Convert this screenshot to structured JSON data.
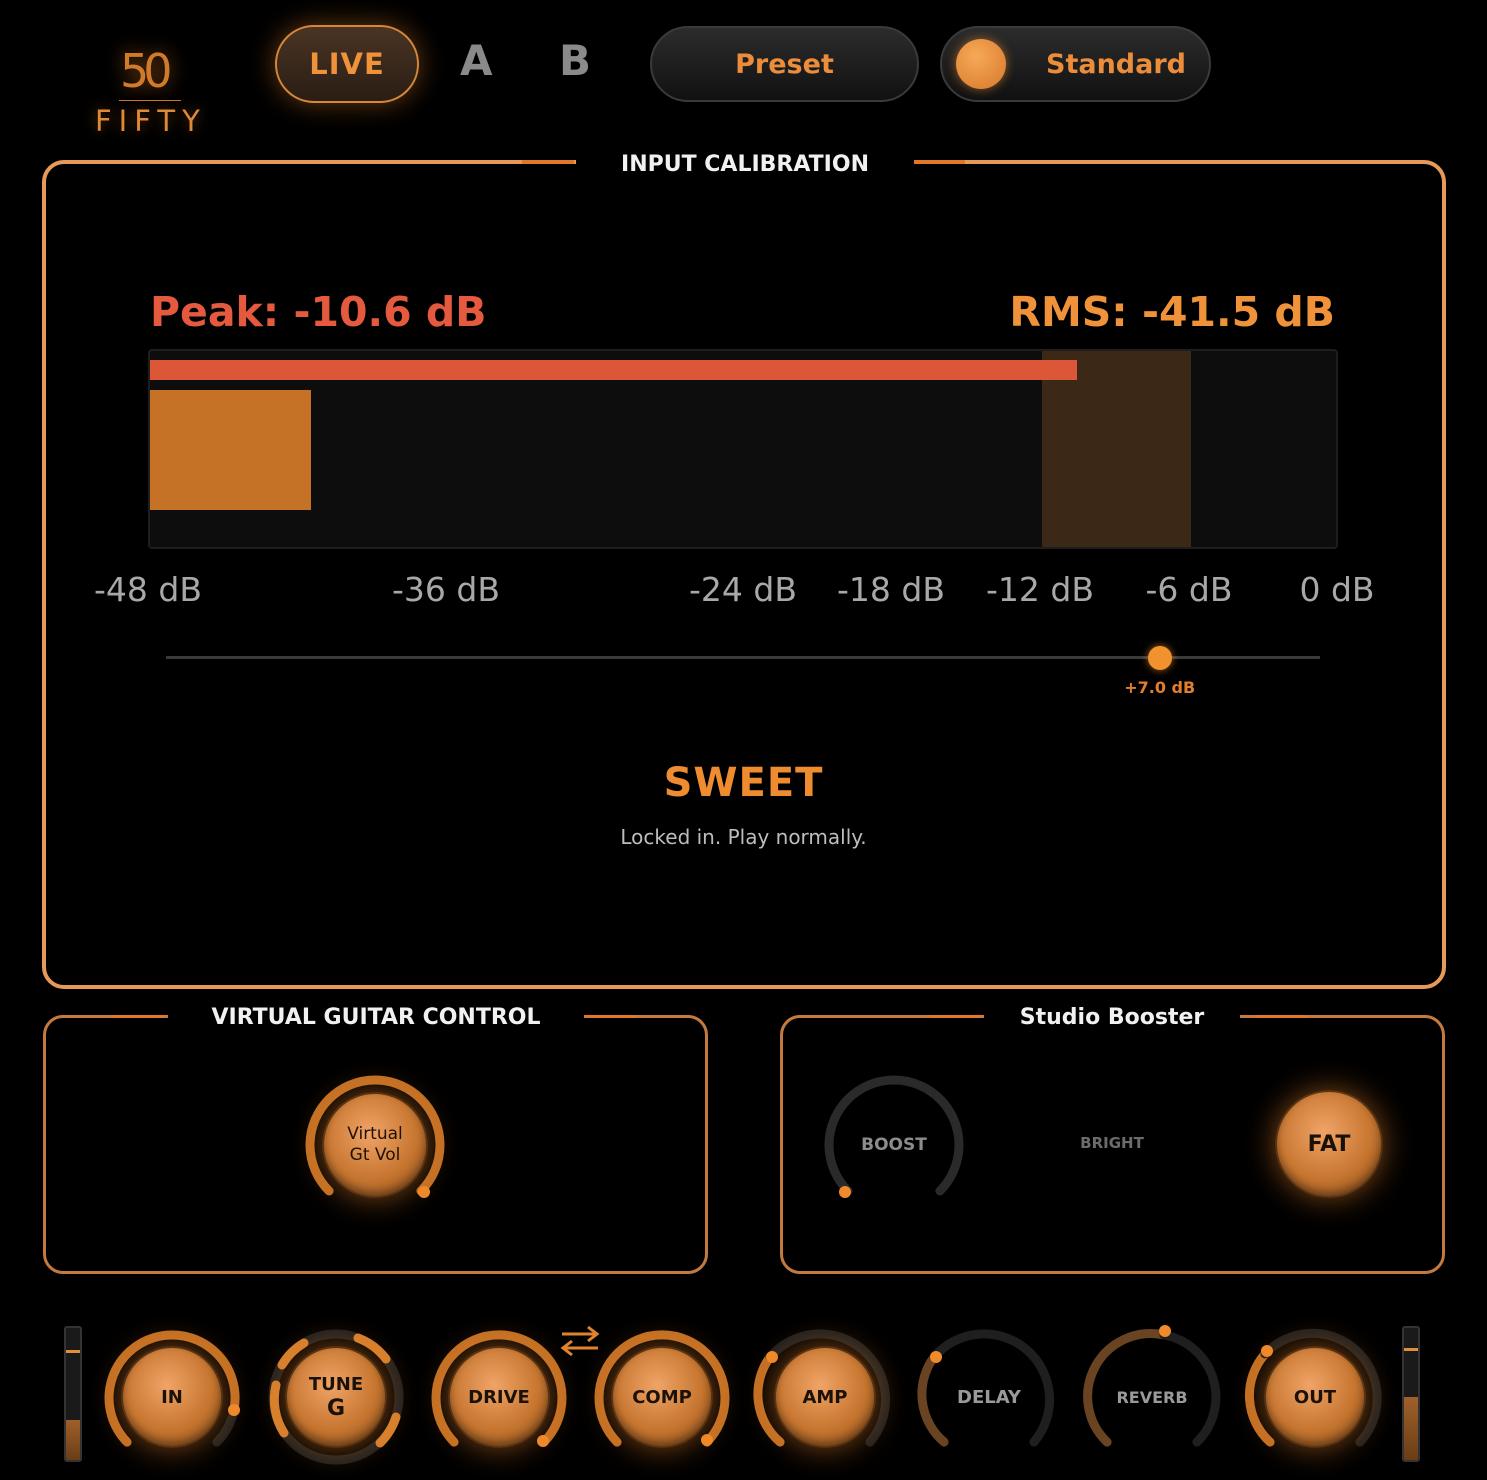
{
  "logo": {
    "number": "50",
    "word": "FIFTY"
  },
  "header": {
    "mode_live": "LIVE",
    "slot_a": "A",
    "slot_b": "B",
    "preset_label": "Preset",
    "standard_label": "Standard"
  },
  "calibration": {
    "title": "INPUT CALIBRATION",
    "peak_text": "Peak: -10.6 dB",
    "rms_text": "RMS: -41.5 dB",
    "peak_db": -10.6,
    "rms_db": -41.5,
    "sweet_zone_db": [
      -12,
      -6
    ],
    "scale_min_db": -48,
    "scale_max_db": 0,
    "ticks": [
      {
        "db": -48,
        "label": "-48 dB"
      },
      {
        "db": -36,
        "label": "-36 dB"
      },
      {
        "db": -24,
        "label": "-24 dB"
      },
      {
        "db": -18,
        "label": "-18 dB"
      },
      {
        "db": -12,
        "label": "-12 dB"
      },
      {
        "db": -6,
        "label": "-6 dB"
      },
      {
        "db": 0,
        "label": "0 dB"
      }
    ],
    "gain_value": 7.0,
    "gain_range": [
      -24,
      12
    ],
    "gain_label": "+7.0 dB",
    "status": "SWEET",
    "status_sub": "Locked in. Play normally."
  },
  "virtual_guitar": {
    "title": "VIRTUAL GUITAR CONTROL",
    "knob_label": "Virtual\nGt Vol"
  },
  "booster": {
    "title": "Studio Booster",
    "boost_label": "BOOST",
    "bright_label": "BRIGHT",
    "fat_label": "FAT"
  },
  "chain": {
    "in_label": "IN",
    "tune_label": "TUNE",
    "tune_note": "G",
    "drive_label": "DRIVE",
    "comp_label": "COMP",
    "amp_label": "AMP",
    "delay_label": "DELAY",
    "reverb_label": "REVERB",
    "out_label": "OUT",
    "in_level": 0.3,
    "out_level": 0.48
  },
  "colors": {
    "accent": "#f0923a",
    "peak": "#dc5638",
    "rms": "#c57227",
    "panel_border": "#e79a58"
  }
}
